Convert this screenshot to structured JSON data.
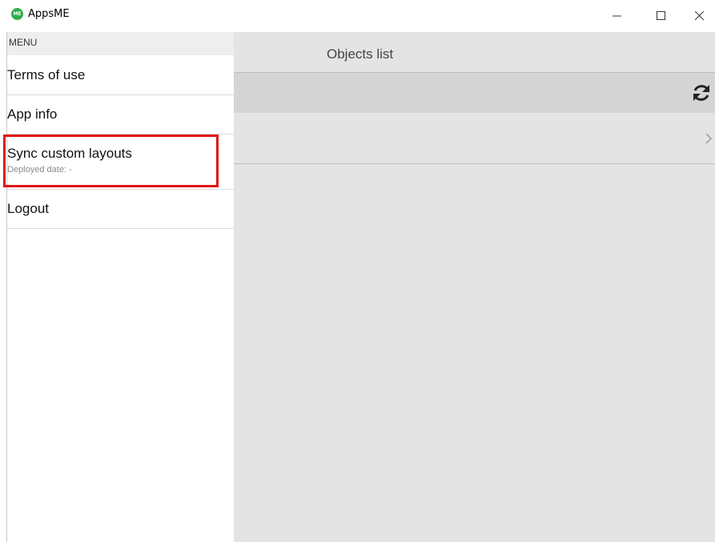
{
  "window": {
    "title": "AppsME",
    "logo_text": "ME",
    "logo_color": "#2fae4b"
  },
  "menu": {
    "header": "MENU",
    "items": [
      {
        "label": "Terms of use",
        "sub": ""
      },
      {
        "label": "App info",
        "sub": ""
      },
      {
        "label": "Sync custom layouts",
        "sub": "Deployed date: -"
      },
      {
        "label": "Logout",
        "sub": ""
      }
    ],
    "highlighted_item": "Sync custom layouts",
    "highlight_color": "#e11010"
  },
  "main": {
    "title": "Objects list",
    "toolbar_icon": "sync-icon",
    "rows": [
      {
        "label": "",
        "icon": "chevron-right-icon"
      }
    ]
  }
}
